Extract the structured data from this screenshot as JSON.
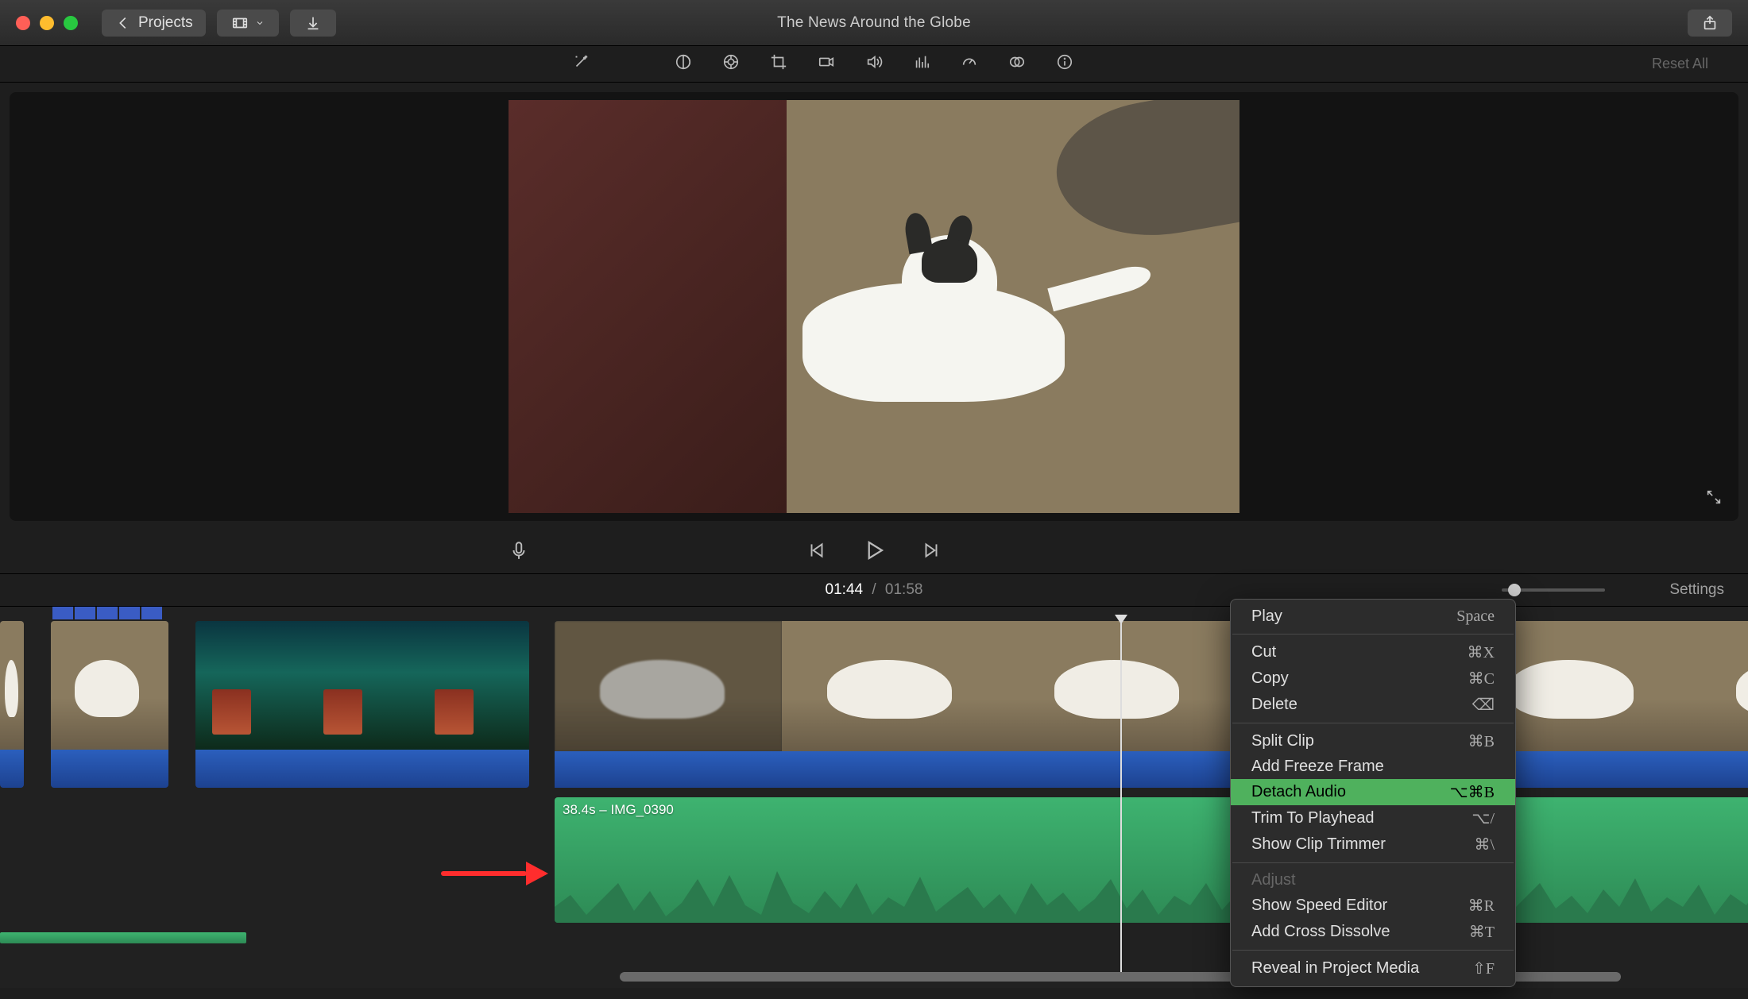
{
  "titlebar": {
    "projects_label": "Projects",
    "title": "The News Around the Globe"
  },
  "adjust": {
    "reset_label": "Reset All"
  },
  "timeline": {
    "current_time": "01:44",
    "total_time": "01:58",
    "time_separator": "/",
    "settings_label": "Settings",
    "detached_audio_label": "38.4s – IMG_0390"
  },
  "context_menu": {
    "items": [
      {
        "label": "Play",
        "shortcut": "Space",
        "group": 0
      },
      {
        "label": "Cut",
        "shortcut": "⌘X",
        "group": 1
      },
      {
        "label": "Copy",
        "shortcut": "⌘C",
        "group": 1
      },
      {
        "label": "Delete",
        "shortcut": "⌫",
        "group": 1
      },
      {
        "label": "Split Clip",
        "shortcut": "⌘B",
        "group": 2
      },
      {
        "label": "Add Freeze Frame",
        "shortcut": "",
        "group": 2
      },
      {
        "label": "Detach Audio",
        "shortcut": "⌥⌘B",
        "group": 2,
        "highlighted": true
      },
      {
        "label": "Trim To Playhead",
        "shortcut": "⌥/",
        "group": 2
      },
      {
        "label": "Show Clip Trimmer",
        "shortcut": "⌘\\",
        "group": 2
      },
      {
        "label": "Adjust",
        "shortcut": "",
        "group": 3,
        "disabled": true
      },
      {
        "label": "Show Speed Editor",
        "shortcut": "⌘R",
        "group": 3
      },
      {
        "label": "Add Cross Dissolve",
        "shortcut": "⌘T",
        "group": 3
      },
      {
        "label": "Reveal in Project Media",
        "shortcut": "⇧F",
        "group": 4
      }
    ]
  },
  "icons": {
    "back_chevron": "chevron-left-icon",
    "filmstrip": "filmstrip-icon",
    "download": "download-icon",
    "share": "share-icon",
    "wand": "wand-icon",
    "contrast": "contrast-icon",
    "color": "color-wheel-icon",
    "crop": "crop-icon",
    "camera": "camera-icon",
    "volume": "volume-icon",
    "eq": "equalizer-icon",
    "speed": "speedometer-icon",
    "overlay": "overlay-icon",
    "info": "info-icon",
    "mic": "microphone-icon",
    "prev": "skip-back-icon",
    "play": "play-icon",
    "next": "skip-forward-icon",
    "fullscreen": "fullscreen-icon"
  },
  "colors": {
    "accent_blue": "#2e6fd6",
    "accent_green": "#3eb370",
    "menu_highlight": "#4fb15d",
    "annotation_red": "#ff2d2d"
  }
}
